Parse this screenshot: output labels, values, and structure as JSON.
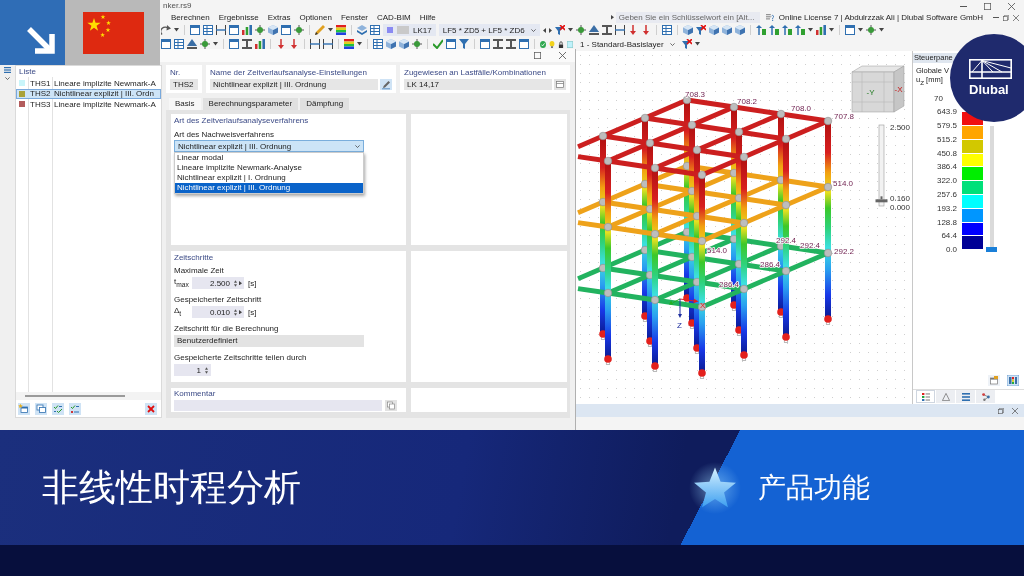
{
  "app": {
    "title": "nker.rs9",
    "menu": [
      "Berechnen",
      "Ergebnisse",
      "Extras",
      "Optionen",
      "Fenster",
      "CAD-BIM",
      "Hilfe"
    ],
    "search": {
      "placeholder": "Geben Sie ein Schlüsselwort ein [Alt..."
    },
    "license": "Online License 7 | Abdulrzzak Ali | Dlubal Software GmbH",
    "load_case": "LK17",
    "combination": "LF5 * ZD5 + LF5 * ZD6",
    "layer": "1 - Standard-Basislayer"
  },
  "dialog": {
    "list": {
      "title": "Liste",
      "items": [
        {
          "id": "THS1",
          "name": "Lineare implizite Newmark-A",
          "color": "#c9f5fa",
          "selected": false
        },
        {
          "id": "THS2",
          "name": "Nichtlinear explizit | III. Ordn",
          "color": "#a9a23a",
          "selected": true
        },
        {
          "id": "THS3",
          "name": "Lineare implizite Newmark-A",
          "color": "#b35c5c",
          "selected": false
        }
      ]
    },
    "number": {
      "label": "Nr.",
      "value": "THS2"
    },
    "name": {
      "label": "Name der Zeitverlaufsanalyse-Einstellungen",
      "value": "Nichtlinear explizit | III. Ordnung"
    },
    "assigned": {
      "label": "Zugewiesen an Lastfälle/Kombinationen",
      "value": "LK 14,17"
    },
    "tabs": [
      {
        "label": "Basis",
        "selected": true
      },
      {
        "label": "Berechnungsparameter",
        "selected": false
      },
      {
        "label": "Dämpfung",
        "selected": false
      }
    ],
    "method": {
      "section": "Art des Zeitverlaufsanalyseverfahrens",
      "label": "Art des Nachweisverfahrens",
      "value": "Nichtlinear explizit | III. Ordnung",
      "expanded": true,
      "options": [
        {
          "label": "Linear modal",
          "selected": false
        },
        {
          "label": "Lineare implizite Newmark-Analyse",
          "selected": false
        },
        {
          "label": "Nichtlinear explizit | I. Ordnung",
          "selected": false
        },
        {
          "label": "Nichtlinear explizit | III. Ordnung",
          "selected": true
        }
      ]
    },
    "time_steps": {
      "section": "Zeitschritte",
      "fields": [
        {
          "kind": "spinner",
          "label": "Maximale Zeit",
          "symbol": "t$_{max}$",
          "value": "2.500",
          "unit": "[s]"
        },
        {
          "kind": "spinner",
          "label": "Gespeicherter Zeitschritt",
          "symbol": "Δ$_{t}$",
          "value": "0.010",
          "unit": "[s]"
        },
        {
          "kind": "select",
          "label": "Zeitschritt für die Berechnung",
          "value": "Benutzerdefiniert"
        },
        {
          "kind": "counter",
          "label": "Gespeicherte Zeitschritte teilen durch",
          "value": "1"
        }
      ]
    },
    "comment": {
      "section": "Kommentar"
    }
  },
  "viewport": {
    "view_cube": [
      "-Y",
      "-X"
    ],
    "time_slider": {
      "max": "2.500",
      "current": "0.160",
      "min": "0.000",
      "level": 0.064
    },
    "axes": [
      "X",
      "Z"
    ],
    "node_labels": [
      "708.3",
      "708.2",
      "708.0",
      "707.8",
      "514.0",
      "514.0",
      "292.4",
      "292.4",
      "292.2",
      "286.4",
      "286.4"
    ]
  },
  "control_panel": {
    "title": "Steuerpane",
    "quantity": "Globale V",
    "unit": "u$_{Z}$ [mm]",
    "scale": [
      "70",
      "643.9",
      "579.5",
      "515.2",
      "450.8",
      "386.4",
      "322.0",
      "257.6",
      "193.2",
      "128.8",
      "64.4",
      "0.0"
    ],
    "bands": [
      {
        "color": "#f01010"
      },
      {
        "color": "#ffa500"
      },
      {
        "color": "#d2c800"
      },
      {
        "color": "#ffff00"
      },
      {
        "color": "#00ee00"
      },
      {
        "color": "#00e07a"
      },
      {
        "color": "#00ffff"
      },
      {
        "color": "#0096ff"
      },
      {
        "color": "#0000ff"
      },
      {
        "color": "#000096"
      }
    ],
    "range_slider": {
      "level": 0
    },
    "tabs": [
      {
        "selected": true
      },
      {
        "selected": false
      },
      {
        "selected": false
      },
      {
        "selected": false
      }
    ]
  },
  "logo": "Dlubal",
  "banner": {
    "title": "非线性时程分析",
    "tag": "产品功能"
  }
}
